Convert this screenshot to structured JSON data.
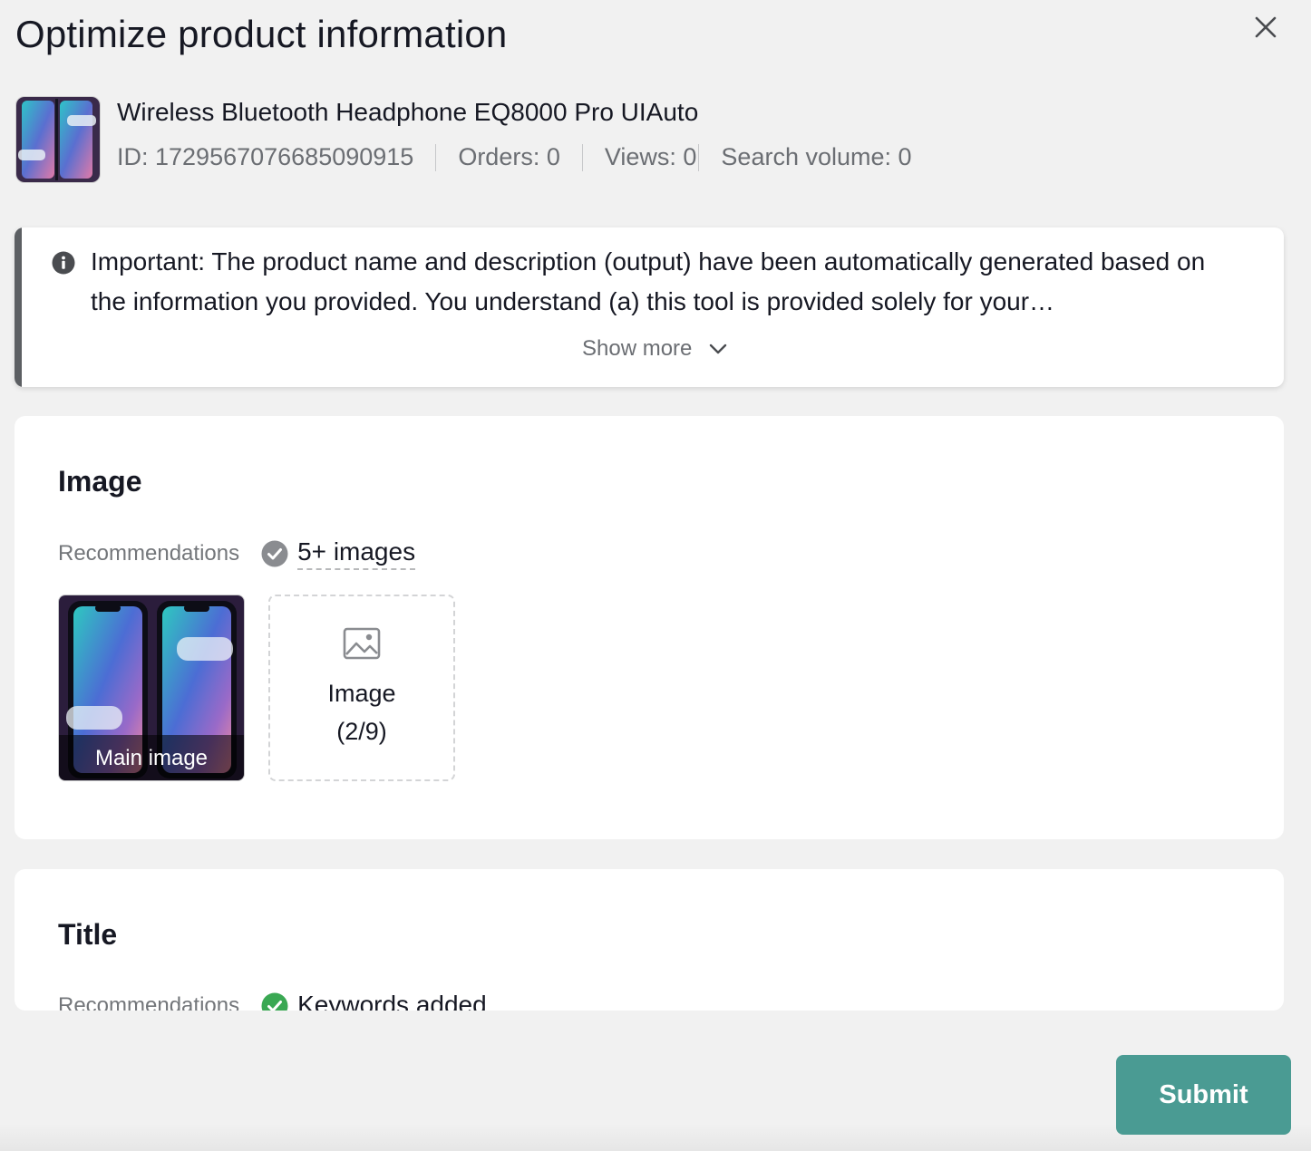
{
  "modal": {
    "title": "Optimize product information",
    "close_icon": "close-icon"
  },
  "product": {
    "name": "Wireless Bluetooth Headphone EQ8000 Pro UIAuto",
    "id_text": "ID: 1729567076685090915",
    "orders_text": "Orders: 0",
    "views_text": "Views: 0",
    "search_volume_text": "Search volume: 0"
  },
  "notice": {
    "icon": "info-icon",
    "text": "Important: The product name and description (output) have been automatically generated based on the information you provided. You understand (a) this tool is provided solely for your…",
    "show_more_label": "Show more",
    "chevron_icon": "chevron-down-icon"
  },
  "image_section": {
    "title": "Image",
    "recommendations_label": "Recommendations",
    "recommendation_value": "5+ images",
    "recommendation_status": "met-gray",
    "main_image_label": "Main image",
    "upload_line1": "Image",
    "upload_line2": "(2/9)"
  },
  "title_section": {
    "title": "Title",
    "recommendations_label": "Recommendations",
    "recommendation_value": "Keywords added",
    "recommendation_status": "met-green"
  },
  "footer": {
    "submit_label": "Submit"
  },
  "colors": {
    "accent": "#4a9b93",
    "success_green": "#3aa853",
    "muted_check": "#8a8c90",
    "notice_bar": "#5c5f63"
  }
}
